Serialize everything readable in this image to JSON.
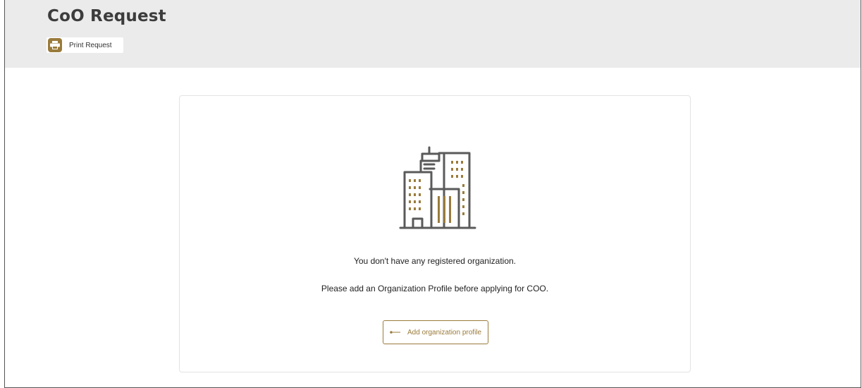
{
  "header": {
    "title": "CoO Request",
    "print_label": "Print Request"
  },
  "empty_state": {
    "message_primary": "You don't have any registered organization.",
    "message_secondary": "Please add an Organization Profile before applying for COO.",
    "action_label": "Add organization profile",
    "illustration_icon": "office-buildings-icon"
  },
  "colors": {
    "accent": "#9a7b3b",
    "header_bg": "#ebebeb",
    "icon_stroke": "#5a5a5a"
  }
}
